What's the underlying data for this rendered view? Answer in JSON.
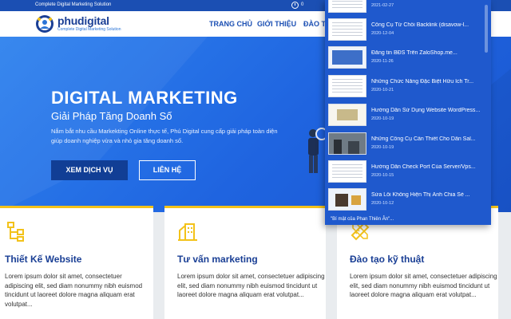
{
  "topbar": {
    "tagline": "Complete Digital Marketing Solution",
    "info": "0"
  },
  "logo": {
    "name": "phudigital",
    "subtitle": "Complete Digital Marketing Solution"
  },
  "nav": {
    "items": [
      "TRANG CHỦ",
      "GIỚI THIỆU",
      "ĐÀO T"
    ]
  },
  "hero": {
    "title": "DIGITAL MARKETING",
    "subtitle": "Giải Pháp Tăng Doanh Số",
    "description": "Nắm bắt nhu cầu Markekting Online thực tế, Phú Digital cung cấp giải pháp toàn diện giúp doanh nghiệp vừa và nhỏ gia tăng doanh số.",
    "primary_button": "XEM DỊCH VỤ",
    "secondary_button": "LIÊN HỆ"
  },
  "features": [
    {
      "title": "Thiết Kế Website",
      "icon": "sitemap-icon",
      "text": "Lorem ipsum dolor sit amet, consectetuer adipiscing elit, sed diam nonummy nibh euismod tincidunt ut laoreet dolore magna aliquam erat volutpat..."
    },
    {
      "title": "Tư vấn marketing",
      "icon": "buildings-icon",
      "text": "Lorem ipsum dolor sit amet, consectetuer adipiscing elit, sed diam nonummy nibh euismod tincidunt ut laoreet dolore magna aliquam erat volutpat..."
    },
    {
      "title": "Đào tạo kỹ thuật",
      "icon": "ruler-pencil-icon",
      "text": "Lorem ipsum dolor sit amet, consectetuer adipiscing elit, sed diam nonummy nibh euismod tincidunt ut laoreet dolore magna aliquam erat volutpat..."
    }
  ],
  "popup": {
    "items": [
      {
        "title": "",
        "date": "2021-02-27"
      },
      {
        "title": "Công Cụ Từ Chối Backlink (disavow-l...",
        "date": "2020-12-04"
      },
      {
        "title": "Đăng tin BĐS Trên ZaloShop.me...",
        "date": "2020-11-26"
      },
      {
        "title": "Những Chức Năng Đặc Biệt Hữu Ích Tr...",
        "date": "2020-10-21"
      },
      {
        "title": "Hướng Dẫn Sử Dụng Website WordPress...",
        "date": "2020-10-19"
      },
      {
        "title": "Những Công Cụ Cần Thiết Cho Dân Sal...",
        "date": "2020-10-19"
      },
      {
        "title": "Hướng Dẫn Check Port Của Server/Vps...",
        "date": "2020-10-15"
      },
      {
        "title": "Sửa Lỗi Không Hiện Thị Ảnh Chia Sẻ ...",
        "date": "2020-10-12"
      }
    ],
    "footer": "\"Bí mật của Phan Thiên Ân\"..."
  },
  "colors": {
    "brand_blue": "#1b4fb3",
    "hero_blue": "#1f64e0",
    "accent_yellow": "#f3c21a"
  }
}
